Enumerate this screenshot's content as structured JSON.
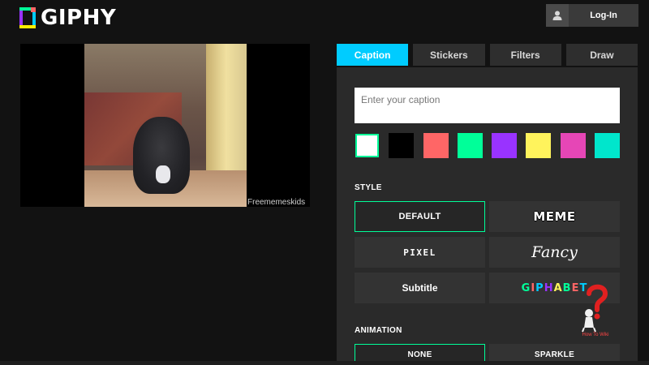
{
  "header": {
    "logo_text": "GIPHY",
    "login_label": "Log-In"
  },
  "preview": {
    "watermark": "Freememeskids"
  },
  "tabs": [
    {
      "label": "Caption",
      "active": true
    },
    {
      "label": "Stickers",
      "active": false
    },
    {
      "label": "Filters",
      "active": false
    },
    {
      "label": "Draw",
      "active": false
    }
  ],
  "caption": {
    "placeholder": "Enter your caption",
    "value": ""
  },
  "colors": [
    {
      "name": "white",
      "hex": "#ffffff",
      "selected": true
    },
    {
      "name": "black",
      "hex": "#000000",
      "selected": false
    },
    {
      "name": "red",
      "hex": "#ff6666",
      "selected": false
    },
    {
      "name": "green",
      "hex": "#00ff99",
      "selected": false
    },
    {
      "name": "purple",
      "hex": "#9933ff",
      "selected": false
    },
    {
      "name": "yellow",
      "hex": "#fff35c",
      "selected": false
    },
    {
      "name": "pink",
      "hex": "#e646b6",
      "selected": false
    },
    {
      "name": "cyan",
      "hex": "#00e6cc",
      "selected": false
    }
  ],
  "style": {
    "label": "STYLE",
    "options": {
      "default": "DEFAULT",
      "meme": "MEME",
      "pixel": "PIXEL",
      "fancy": "Fancy",
      "subtitle": "Subtitle",
      "giphabet": "GIPHABET"
    },
    "selected": "default"
  },
  "animation": {
    "label": "ANIMATION",
    "options": {
      "none": "NONE",
      "sparkle": "SPARKLE"
    },
    "selected": "none"
  },
  "watermark_badge": {
    "caption": "How To Wiki"
  },
  "theme": {
    "accent": "#00ccff",
    "selection": "#00ff99",
    "background": "#121212",
    "panel": "#2a2a2a"
  }
}
